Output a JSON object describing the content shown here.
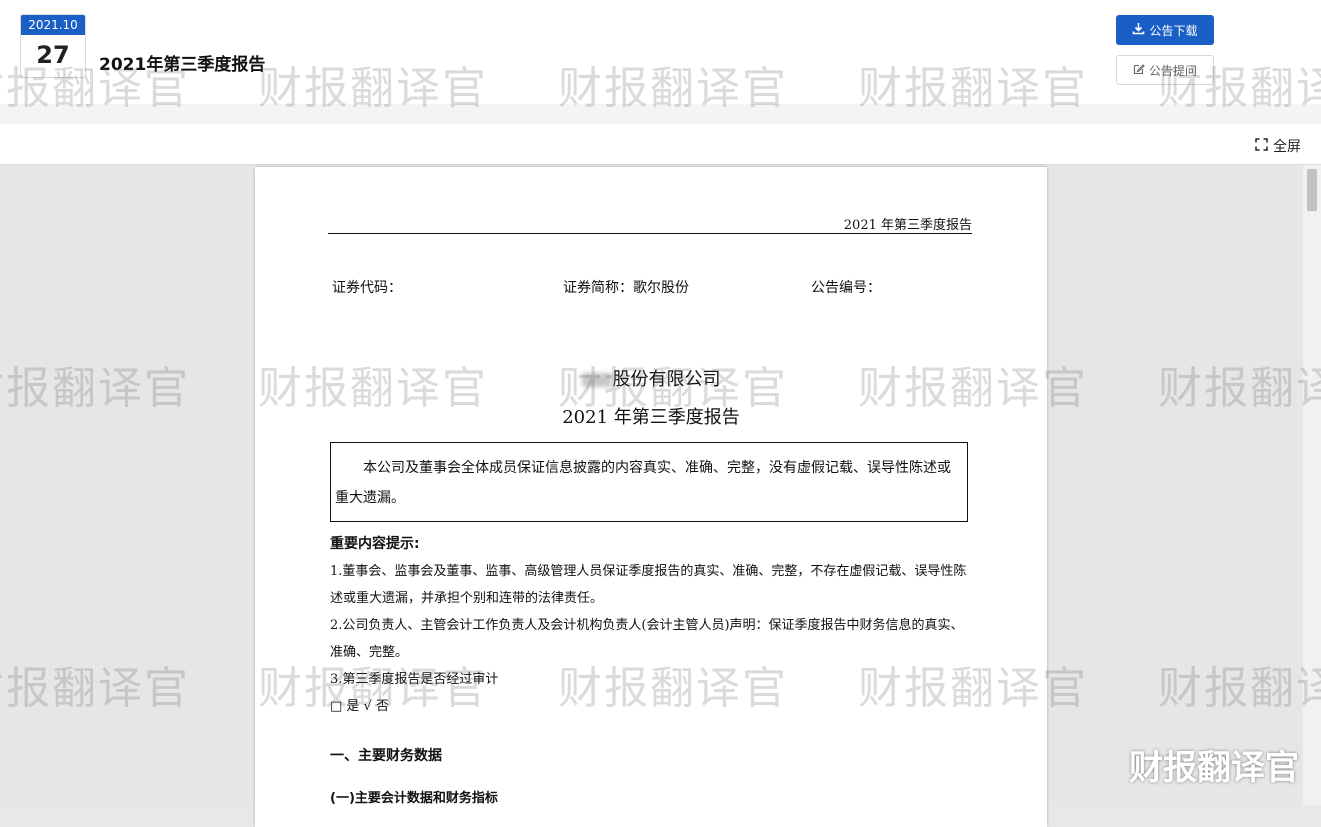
{
  "header": {
    "date_month": "2021.10",
    "date_day": "27",
    "title": "2021年第三季度报告",
    "download_label": "公告下载",
    "ask_label": "公告提问"
  },
  "toolbar": {
    "fullscreen_label": "全屏"
  },
  "document": {
    "header_text": "2021 年第三季度报告",
    "securities_code_label": "证券代码：",
    "securities_name_label": "证券简称：歌尔股份",
    "announcement_no_label": "公告编号：",
    "company_name": "股份有限公司",
    "report_title": "2021 年第三季度报告",
    "box_text": "本公司及董事会全体成员保证信息披露的内容真实、准确、完整，没有虚假记载、误导性陈述或重大遗漏。",
    "tips_title": "重要内容提示:",
    "tip1": "1.董事会、监事会及董事、监事、高级管理人员保证季度报告的真实、准确、完整，不存在虚假记载、误导性陈述或重大遗漏，并承担个别和连带的法律责任。",
    "tip2": "2.公司负责人、主管会计工作负责人及会计机构负责人(会计主管人员)声明：保证季度报告中财务信息的真实、准确、完整。",
    "tip3": "3.第三季度报告是否经过审计",
    "audit_options": "□ 是 √ 否",
    "section1": "一、主要财务数据",
    "section1_1": "(一)主要会计数据和财务指标"
  },
  "watermark": {
    "text": "财报翻译官"
  }
}
